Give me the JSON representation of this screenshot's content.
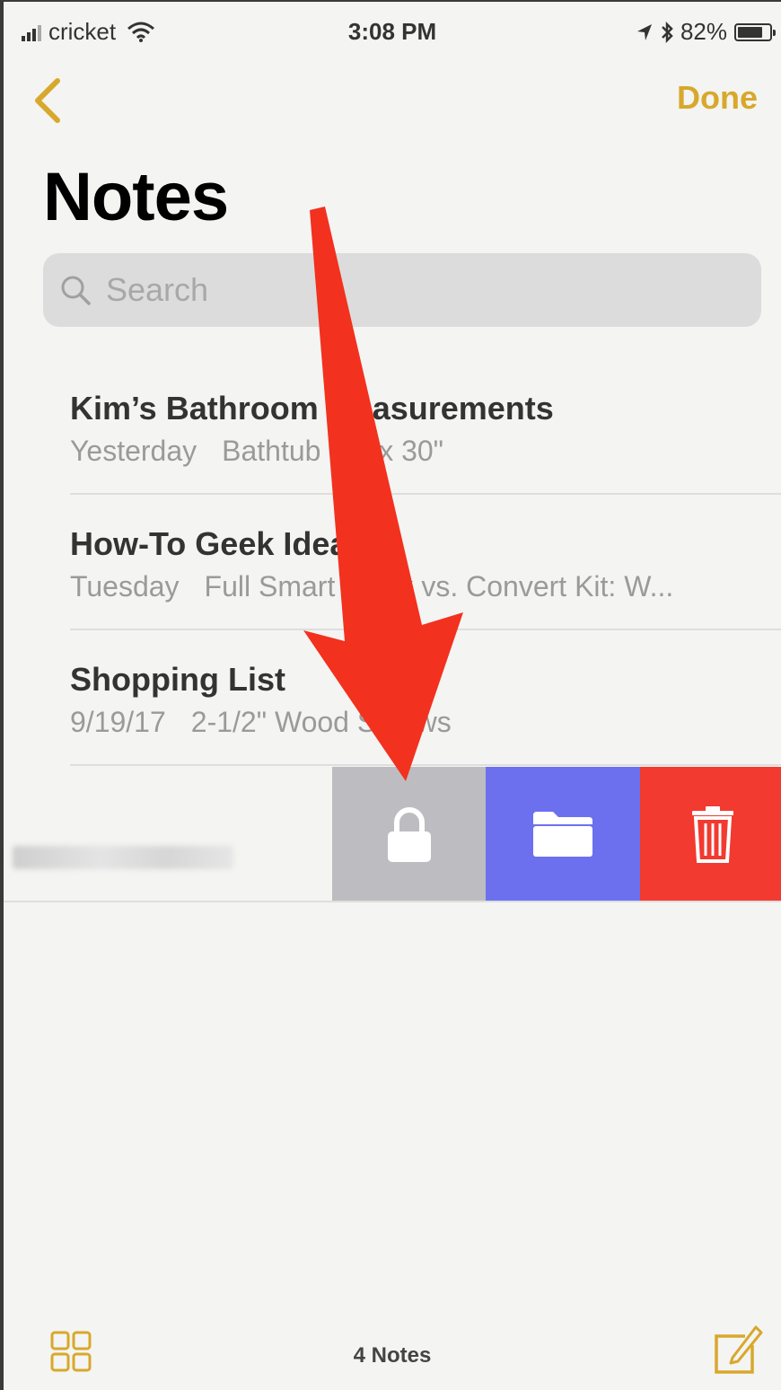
{
  "status_bar": {
    "carrier": "cricket",
    "time": "3:08 PM",
    "battery": "82%"
  },
  "nav": {
    "back_icon": "chevron-left-icon",
    "done_label": "Done"
  },
  "page_title": "Notes",
  "search": {
    "placeholder": "Search",
    "icon": "search-icon"
  },
  "notes": [
    {
      "title": "Kim’s Bathroom Measurements",
      "date": "Yesterday",
      "preview": "Bathtub 60\" x 30\""
    },
    {
      "title": "How-To Geek Ideas",
      "date": "Tuesday",
      "preview": "Full Smart Track vs. Convert Kit: W..."
    },
    {
      "title": "Shopping List",
      "date": "9/19/17",
      "preview": "2-1/2\" Wood Screws"
    }
  ],
  "swipe_actions": [
    {
      "name": "lock",
      "icon": "lock-icon",
      "color": "#bdbdc1"
    },
    {
      "name": "move",
      "icon": "folder-icon",
      "color": "#6c70ee"
    },
    {
      "name": "delete",
      "icon": "trash-icon",
      "color": "#f23a30"
    }
  ],
  "toolbar": {
    "note_count": "4 Notes"
  },
  "colors": {
    "accent": "#d8a82c",
    "arrow": "#f2311f"
  }
}
